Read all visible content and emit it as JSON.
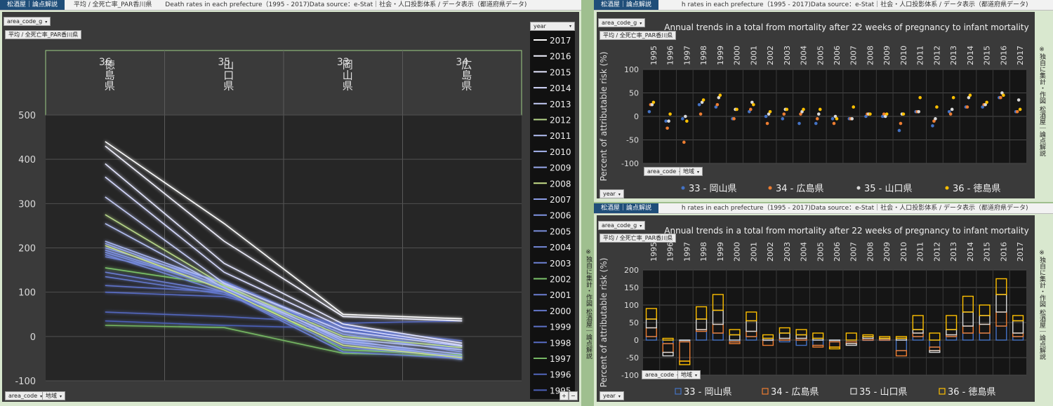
{
  "header": {
    "brand": "松酒屋｜論点解説",
    "left_title": "平均 / 全死亡率_PAR香川県",
    "left_subtitle": "Death rates in each prefecture（1995 - 2017)Data source：e-Stat｜社会・人口投影体系 / データ表示（都道府県データ)",
    "right_subtitle": "h rates in each prefecture（1995 - 2017)Data source：e-Stat｜社会・人口投影体系 / データ表示（都道府県データ)"
  },
  "controls": {
    "area_code_g": "area_code_g",
    "area_code": "area_code",
    "chiiki": "地域",
    "year": "year",
    "filter_label": "平均 / 全死亡率_PAR香川県",
    "plus": "+",
    "minus": "−"
  },
  "side_note": "※独自に集計・作図  松酒屋｜論点解説",
  "legend_years": [
    "2017",
    "2016",
    "2015",
    "2014",
    "2013",
    "2012",
    "2011",
    "2010",
    "2009",
    "2008",
    "2007",
    "2006",
    "2005",
    "2004",
    "2003",
    "2002",
    "2001",
    "2000",
    "1999",
    "1998",
    "1997",
    "1996",
    "1995"
  ],
  "year_colors": {
    "2017": "#ffffff",
    "2016": "#f2f2ff",
    "2015": "#e4e6ff",
    "2014": "#d6daff",
    "2013": "#c6cdf8",
    "2012": "#b8d88a",
    "2011": "#b4c0f4",
    "2010": "#a8b6f0",
    "2009": "#98a8ec",
    "2008": "#c8e08a",
    "2007": "#8c9ee8",
    "2006": "#8094e2",
    "2005": "#7a8edc",
    "2004": "#7488d8",
    "2003": "#6e82d4",
    "2002": "#7cc46a",
    "2001": "#6a7ed0",
    "2000": "#6478cc",
    "1999": "#5e72c8",
    "1998": "#586cc4",
    "1997": "#76b864",
    "1996": "#5266bc",
    "1995": "#4c60b8"
  },
  "colors": {
    "okayama": "#4472c4",
    "hiroshima": "#ed7d31",
    "yamaguchi": "#d9d9d9",
    "tokushima": "#ffc000"
  },
  "chart_data": [
    {
      "type": "line",
      "title": "",
      "categories": [
        {
          "code": "36",
          "name": "徳島県"
        },
        {
          "code": "35",
          "name": "山口県"
        },
        {
          "code": "33",
          "name": "岡山県"
        },
        {
          "code": "34",
          "name": "広島県"
        }
      ],
      "ylim": [
        -100,
        500
      ],
      "yticks": [
        -100,
        0,
        100,
        200,
        300,
        400,
        500
      ],
      "grid": true,
      "legend_title": "year",
      "legend_position": "right",
      "series": [
        {
          "name": "2017",
          "values": [
            440,
            255,
            50,
            40
          ]
        },
        {
          "name": "2016",
          "values": [
            430,
            215,
            45,
            35
          ]
        },
        {
          "name": "2015",
          "values": [
            390,
            165,
            28,
            -15
          ]
        },
        {
          "name": "2014",
          "values": [
            360,
            145,
            20,
            -20
          ]
        },
        {
          "name": "2013",
          "values": [
            315,
            120,
            12,
            -22
          ]
        },
        {
          "name": "2012",
          "values": [
            275,
            115,
            0,
            -25
          ]
        },
        {
          "name": "2011",
          "values": [
            255,
            110,
            -5,
            -30
          ]
        },
        {
          "name": "2010",
          "values": [
            215,
            118,
            -10,
            -40
          ]
        },
        {
          "name": "2009",
          "values": [
            210,
            112,
            -15,
            -45
          ]
        },
        {
          "name": "2008",
          "values": [
            205,
            105,
            -20,
            -48
          ]
        },
        {
          "name": "2007",
          "values": [
            200,
            122,
            5,
            -35
          ]
        },
        {
          "name": "2006",
          "values": [
            195,
            110,
            -5,
            -50
          ]
        },
        {
          "name": "2005",
          "values": [
            190,
            108,
            -12,
            -52
          ]
        },
        {
          "name": "2004",
          "values": [
            185,
            100,
            -25,
            -45
          ]
        },
        {
          "name": "2003",
          "values": [
            180,
            125,
            10,
            -30
          ]
        },
        {
          "name": "2002",
          "values": [
            155,
            115,
            -30,
            -42
          ]
        },
        {
          "name": "2001",
          "values": [
            145,
            100,
            -35,
            -50
          ]
        },
        {
          "name": "2000",
          "values": [
            135,
            95,
            20,
            -10
          ]
        },
        {
          "name": "1999",
          "values": [
            115,
            100,
            15,
            -20
          ]
        },
        {
          "name": "1998",
          "values": [
            100,
            90,
            25,
            -25
          ]
        },
        {
          "name": "1997",
          "values": [
            25,
            20,
            -38,
            -45
          ]
        },
        {
          "name": "1996",
          "values": [
            55,
            45,
            30,
            35
          ]
        },
        {
          "name": "1995",
          "values": [
            35,
            25,
            18,
            -25
          ]
        }
      ]
    },
    {
      "type": "scatter",
      "title": "Annual trends in a total from mortality after 22 weeks of pregnancy to infant mortality",
      "ylabel": "Percent of attributable risk (%)",
      "x": [
        "1995",
        "1996",
        "1997",
        "1998",
        "1999",
        "2000",
        "2001",
        "2002",
        "2003",
        "2004",
        "2005",
        "2006",
        "2007",
        "2008",
        "2009",
        "2010",
        "2011",
        "2012",
        "2013",
        "2014",
        "2015",
        "2016",
        "2017"
      ],
      "ylim": [
        -100,
        100
      ],
      "yticks": [
        -100,
        -50,
        0,
        50,
        100
      ],
      "grid": true,
      "legend_position": "bottom",
      "series": [
        {
          "name": "33 - 岡山県",
          "values": [
            10,
            -10,
            -5,
            25,
            20,
            -5,
            10,
            0,
            -5,
            -15,
            -15,
            -5,
            -5,
            0,
            0,
            -30,
            10,
            -20,
            10,
            20,
            20,
            40,
            10
          ]
        },
        {
          "name": "34 - 広島県",
          "values": [
            25,
            -25,
            -55,
            5,
            25,
            -5,
            15,
            -15,
            5,
            5,
            -5,
            -15,
            -5,
            5,
            5,
            -15,
            10,
            -10,
            5,
            20,
            25,
            40,
            10
          ]
        },
        {
          "name": "35 - 山口県",
          "values": [
            25,
            -10,
            0,
            30,
            40,
            15,
            30,
            5,
            15,
            10,
            5,
            0,
            -5,
            5,
            0,
            5,
            10,
            -5,
            15,
            40,
            25,
            50,
            35
          ]
        },
        {
          "name": "36 - 徳島県",
          "values": [
            30,
            5,
            -10,
            35,
            45,
            15,
            25,
            10,
            15,
            15,
            15,
            -5,
            20,
            5,
            5,
            5,
            40,
            20,
            40,
            45,
            30,
            45,
            15
          ]
        }
      ]
    },
    {
      "type": "bar",
      "title": "Annual trends in a total from mortality after 22 weeks of pregnancy to infant mortality",
      "ylabel": "Percent of attributable risk (%)",
      "x": [
        "1995",
        "1996",
        "1997",
        "1998",
        "1999",
        "2000",
        "2001",
        "2002",
        "2003",
        "2004",
        "2005",
        "2006",
        "2007",
        "2008",
        "2009",
        "2010",
        "2011",
        "2012",
        "2013",
        "2014",
        "2015",
        "2016",
        "2017"
      ],
      "ylim": [
        -100,
        200
      ],
      "yticks": [
        -100,
        -50,
        0,
        50,
        100,
        150,
        200
      ],
      "stacked": true,
      "grid": true,
      "legend_position": "bottom",
      "series": [
        {
          "name": "33 - 岡山県",
          "values": [
            10,
            -10,
            -5,
            25,
            20,
            -5,
            10,
            0,
            -5,
            -15,
            -15,
            -5,
            -5,
            0,
            0,
            -30,
            10,
            -20,
            10,
            20,
            20,
            40,
            10
          ]
        },
        {
          "name": "34 - 広島県",
          "values": [
            25,
            -25,
            -55,
            5,
            25,
            -5,
            15,
            -15,
            5,
            5,
            -5,
            -15,
            -5,
            5,
            5,
            -15,
            10,
            -10,
            5,
            20,
            25,
            40,
            10
          ]
        },
        {
          "name": "35 - 山口県",
          "values": [
            25,
            -10,
            0,
            30,
            40,
            15,
            30,
            5,
            15,
            10,
            5,
            0,
            -5,
            5,
            0,
            5,
            10,
            -5,
            15,
            40,
            25,
            50,
            35
          ]
        },
        {
          "name": "36 - 徳島県",
          "values": [
            30,
            5,
            -10,
            35,
            45,
            15,
            25,
            10,
            15,
            15,
            15,
            -5,
            20,
            5,
            5,
            5,
            40,
            20,
            40,
            45,
            30,
            45,
            15
          ]
        }
      ]
    }
  ]
}
